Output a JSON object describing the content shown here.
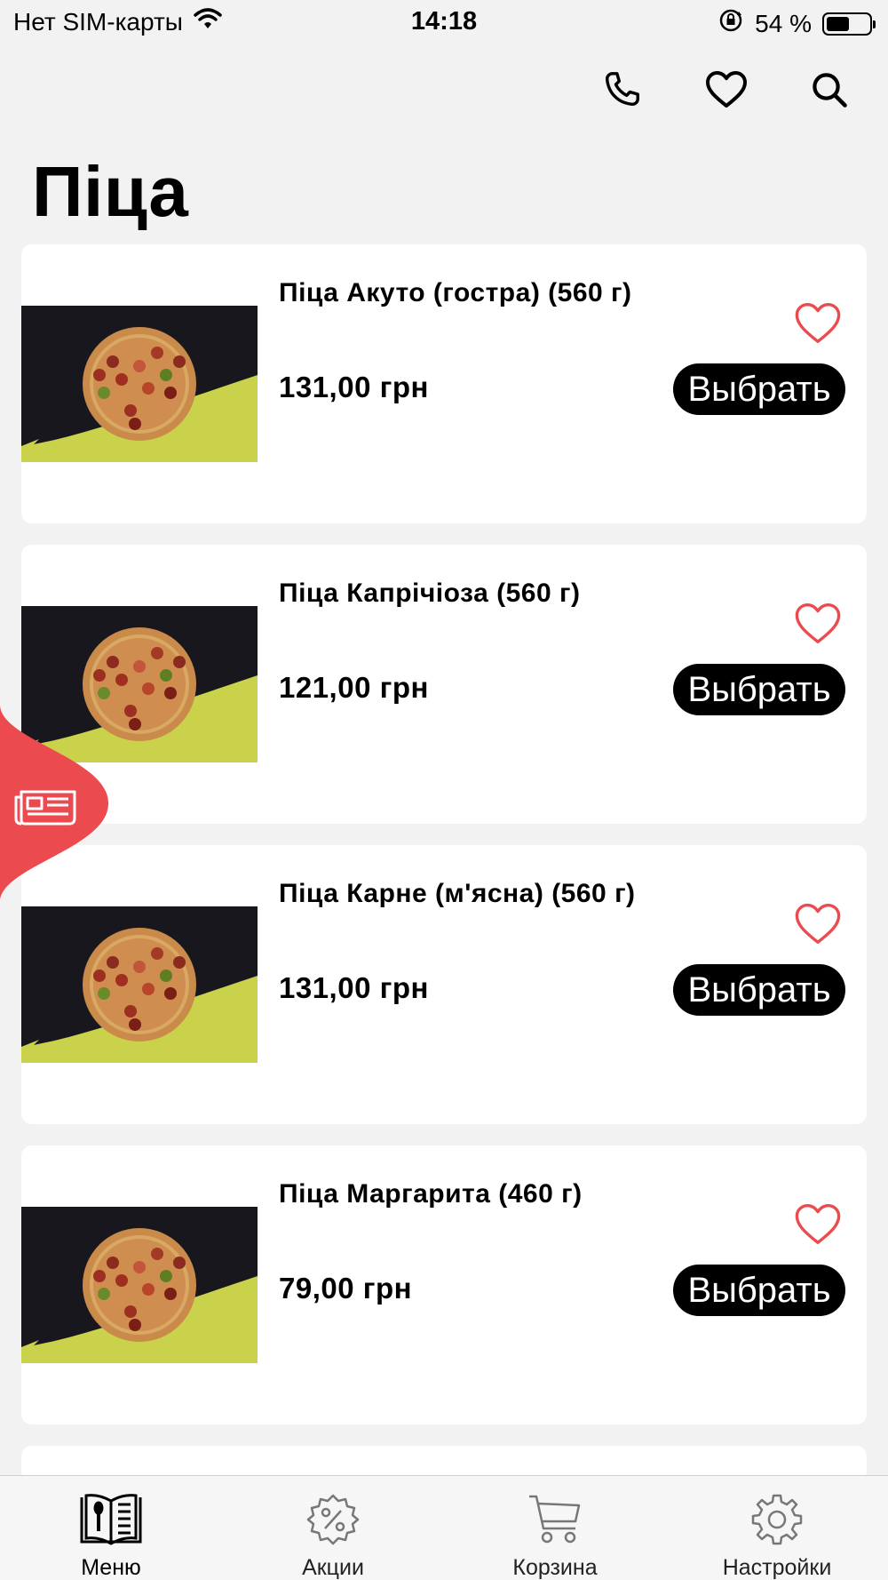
{
  "status_bar": {
    "carrier": "Нет SIM-карты",
    "time": "14:18",
    "battery": "54 %",
    "battery_level": 0.54
  },
  "header": {
    "icons": [
      "phone-icon",
      "heart-icon",
      "search-icon"
    ]
  },
  "page_title": "Піца",
  "products": [
    {
      "name": "Піца Акуто (гостра) (560 г)",
      "price": "131,00 грн",
      "button": "Выбрать"
    },
    {
      "name": "Піца Капрічіоза (560 г)",
      "price": "121,00 грн",
      "button": "Выбрать"
    },
    {
      "name": "Піца Карне (м'ясна) (560 г)",
      "price": "131,00 грн",
      "button": "Выбрать"
    },
    {
      "name": "Піца Маргарита (460 г)",
      "price": "79,00 грн",
      "button": "Выбрать"
    }
  ],
  "colors": {
    "accent": "#eb4b4f",
    "button_bg": "#000000",
    "background": "#f2f2f2",
    "card": "#ffffff",
    "image_yellow": "#c9d24a"
  },
  "tabbar": {
    "tabs": [
      {
        "label": "Меню",
        "icon": "menu-book-icon",
        "active": true
      },
      {
        "label": "Акции",
        "icon": "discount-icon",
        "active": false
      },
      {
        "label": "Корзина",
        "icon": "cart-icon",
        "active": false
      },
      {
        "label": "Настройки",
        "icon": "settings-icon",
        "active": false
      }
    ]
  }
}
